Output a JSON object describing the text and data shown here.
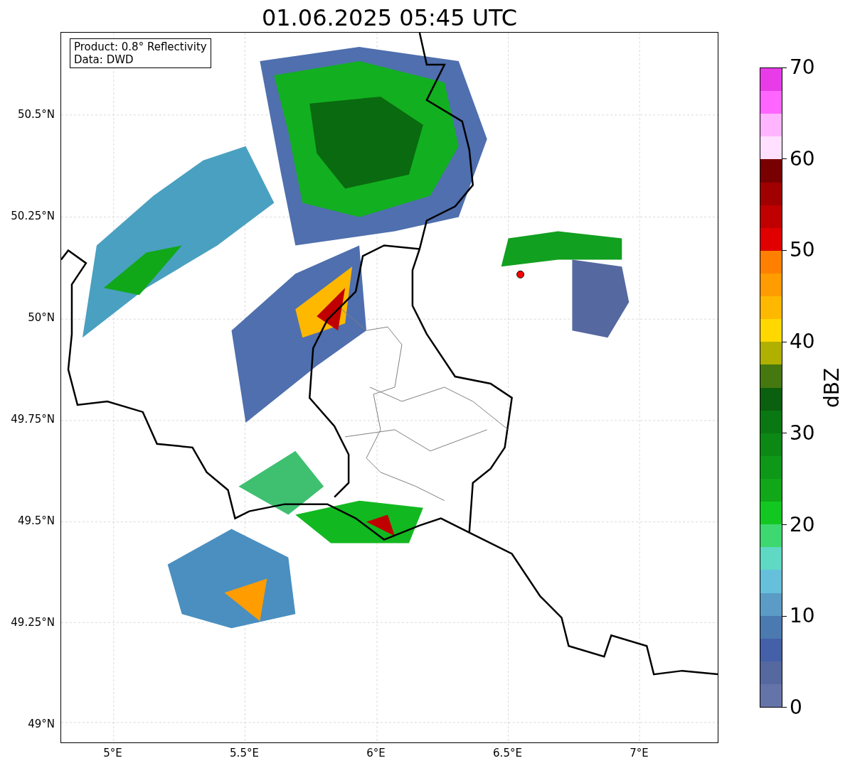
{
  "title": "01.06.2025 05:45 UTC",
  "info_box": [
    "Product: 0.8° Reflectivity",
    "Data: DWD"
  ],
  "y_ticks": [
    "50.5°N",
    "50.25°N",
    "50°N",
    "49.75°N",
    "49.5°N",
    "49.25°N",
    "49°N"
  ],
  "x_ticks": [
    "5°E",
    "5.5°E",
    "6°E",
    "6.5°E",
    "7°E"
  ],
  "colorbar": {
    "label": "dBZ",
    "ticks": [
      "70",
      "60",
      "50",
      "40",
      "30",
      "20",
      "10",
      "0"
    ],
    "segments": [
      {
        "color": "#e83ce8"
      },
      {
        "color": "#ff66ff"
      },
      {
        "color": "#ffb4ff"
      },
      {
        "color": "#ffe0ff"
      },
      {
        "color": "#780000"
      },
      {
        "color": "#a00000"
      },
      {
        "color": "#c00000"
      },
      {
        "color": "#e00000"
      },
      {
        "color": "#ff8000"
      },
      {
        "color": "#ff9c00"
      },
      {
        "color": "#ffb800"
      },
      {
        "color": "#ffd800"
      },
      {
        "color": "#b0b000"
      },
      {
        "color": "#467810"
      },
      {
        "color": "#0a600e"
      },
      {
        "color": "#0a7812"
      },
      {
        "color": "#0c8814"
      },
      {
        "color": "#0e9818"
      },
      {
        "color": "#10a818"
      },
      {
        "color": "#12c820"
      },
      {
        "color": "#3ed870"
      },
      {
        "color": "#5fd8c4"
      },
      {
        "color": "#66c0dc"
      },
      {
        "color": "#5a9cc6"
      },
      {
        "color": "#4a7ab0"
      },
      {
        "color": "#4460a8"
      },
      {
        "color": "#5568a0"
      },
      {
        "color": "#6574a8"
      }
    ]
  }
}
